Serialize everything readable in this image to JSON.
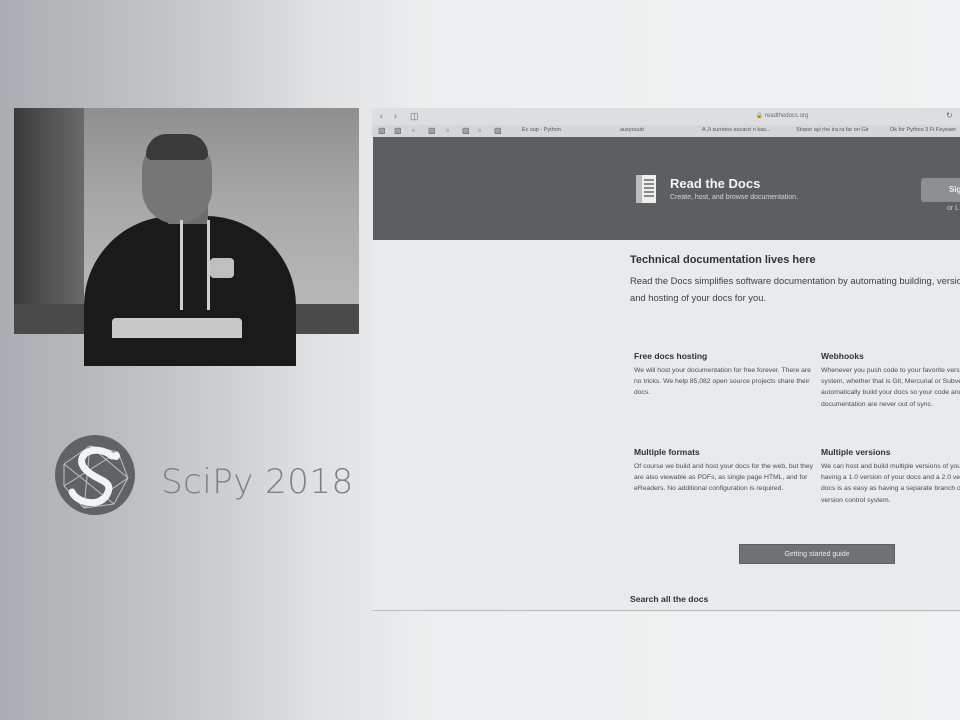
{
  "conference": {
    "name": "SciPy 2018"
  },
  "browser": {
    "url": "readthedocs.org",
    "nav": {
      "back_icon": "chevron-left-icon",
      "forward_icon": "chevron-right-icon",
      "sidebar_icon": "sidebar-icon",
      "reload_icon": "reload-icon"
    },
    "bookmarks": [
      "Ec sup - Python",
      "ausyouub",
      "A Ji surreios eucarzi n kas...",
      "Stoper ayi rhe ira ra far on Gir",
      "Ok for Python 3 Fi Feyeaer"
    ]
  },
  "hero": {
    "title": "Read the Docs",
    "tagline": "Create, host, and browse documentation.",
    "signup_label": "Sig",
    "login_text": "or L"
  },
  "main": {
    "heading": "Technical documentation lives here",
    "lead": "Read the Docs simplifies software documentation by automating building, versioning, and hosting of your docs for you.",
    "features": [
      {
        "title": "Free docs hosting",
        "body": "We will host your documentation for free forever. There are no tricks. We help 85,082 open source projects share their docs."
      },
      {
        "title": "Webhooks",
        "body": "Whenever you push code to your favorite version control system, whether that is Git, Mercurial or Subversion, we will automatically build your docs so your code and documentation are never out of sync."
      },
      {
        "title": "Multiple formats",
        "body": "Of course we build and host your docs for the web, but they are also viewable as PDFs, as single page HTML, and for eReaders. No additional configuration is required."
      },
      {
        "title": "Multiple versions",
        "body": "We can host and build multiple versions of your docs so having a 1.0 version of your docs and a 2.0 version of your docs is as easy as having a separate branch or tag in your version control system."
      }
    ],
    "cta_label": "Getting started guide",
    "search_heading": "Search all the docs"
  }
}
